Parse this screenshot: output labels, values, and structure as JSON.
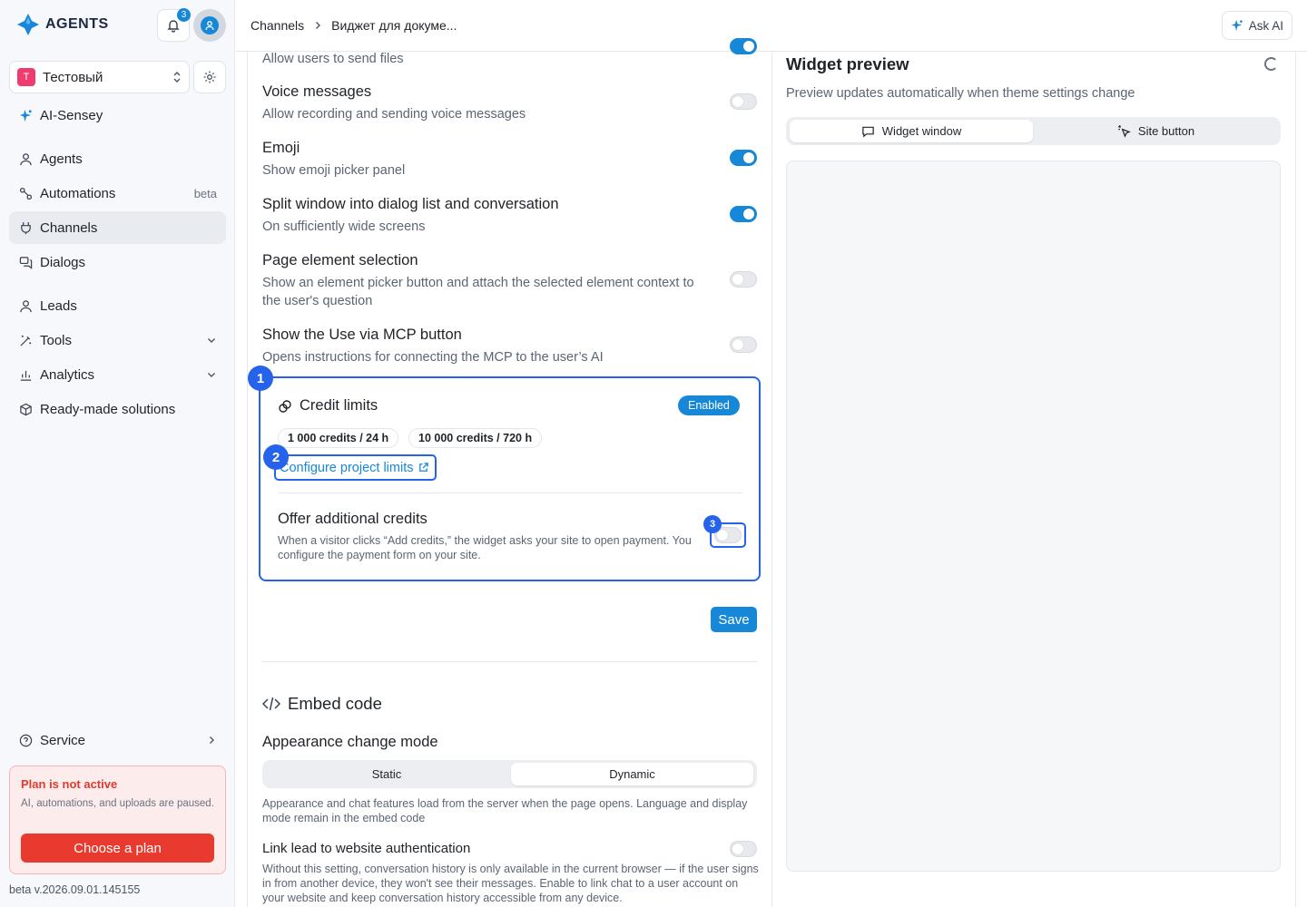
{
  "sidebar": {
    "brand": "AGENTS",
    "notifications_count": "3",
    "project": {
      "initial": "T",
      "name": "Тестовый"
    },
    "ai_item": "AI-Sensey",
    "items": [
      {
        "label": "Agents"
      },
      {
        "label": "Automations",
        "badge": "beta"
      },
      {
        "label": "Channels"
      },
      {
        "label": "Dialogs"
      },
      {
        "label": "Leads"
      },
      {
        "label": "Tools"
      },
      {
        "label": "Analytics"
      },
      {
        "label": "Ready-made solutions"
      }
    ],
    "service": "Service",
    "plan": {
      "title": "Plan is not active",
      "text": "AI, automations, and uploads are paused.",
      "button": "Choose a plan"
    },
    "version": "beta v.2026.09.01.145155"
  },
  "header": {
    "crumb1": "Channels",
    "crumb2": "Виджет для докуме...",
    "ask_ai": "Ask AI"
  },
  "settings": {
    "send_files": {
      "desc": "Allow users to send files",
      "enabled": true
    },
    "voice": {
      "title": "Voice messages",
      "desc": "Allow recording and sending voice messages",
      "enabled": false
    },
    "emoji": {
      "title": "Emoji",
      "desc": "Show emoji picker panel",
      "enabled": true
    },
    "split": {
      "title": "Split window into dialog list and conversation",
      "desc": "On sufficiently wide screens",
      "enabled": true
    },
    "page_element": {
      "title": "Page element selection",
      "desc": "Show an element picker button and attach the selected element context to the user's question",
      "enabled": false
    },
    "mcp": {
      "title": "Show the Use via MCP button",
      "desc": "Opens instructions for connecting the MCP to the user’s AI",
      "enabled": false
    }
  },
  "credit_limits": {
    "marker": "1",
    "title": "Credit limits",
    "status": "Enabled",
    "chips": [
      "1 000 credits / 24 h",
      "10 000 credits / 720 h"
    ],
    "link_marker": "2",
    "link": "Configure project limits",
    "offer_marker": "3",
    "offer_title": "Offer additional credits",
    "offer_desc": "When a visitor clicks “Add credits,” the widget asks your site to open payment. You configure the payment form on your site.",
    "offer_enabled": false
  },
  "save": "Save",
  "embed": {
    "title": "Embed code",
    "mode_title": "Appearance change mode",
    "modes": [
      "Static",
      "Dynamic"
    ],
    "selected_mode": "Dynamic",
    "mode_desc": "Appearance and chat features load from the server when the page opens. Language and display mode remain in the embed code",
    "link_title": "Link lead to website authentication",
    "link_desc": "Without this setting, conversation history is only available in the current browser — if the user signs in from another device, they won't see their messages. Enable to link chat to a user account on your website and keep conversation history accessible from any device.",
    "link_enabled": false
  },
  "preview": {
    "title": "Widget preview",
    "subtitle": "Preview updates automatically when theme settings change",
    "tabs": [
      "Widget window",
      "Site button"
    ],
    "selected_tab": "Widget window"
  },
  "colors": {
    "accent": "#1788d8",
    "highlight": "#2563eb",
    "danger": "#e83a2f"
  }
}
